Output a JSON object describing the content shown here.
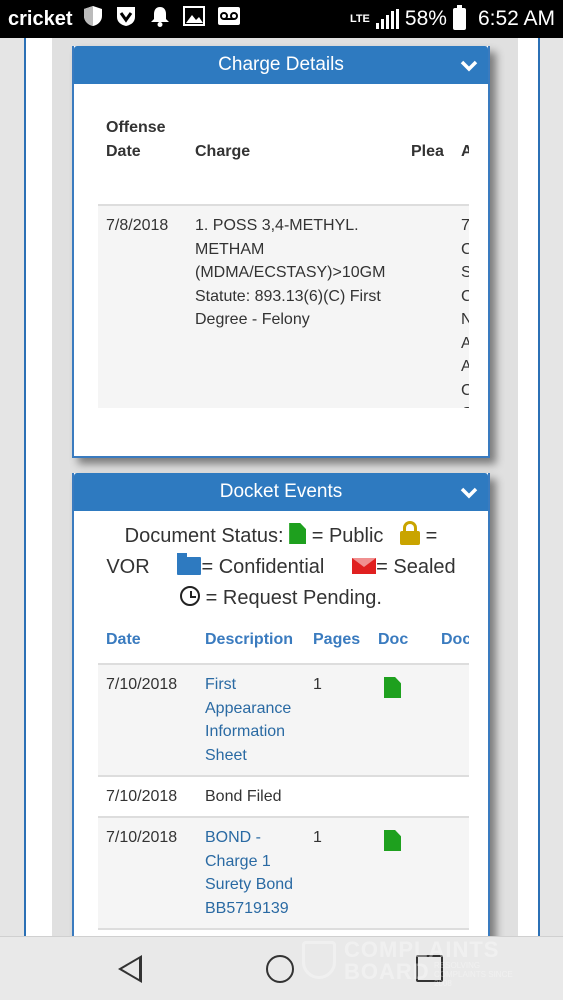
{
  "status_bar": {
    "carrier": "cricket",
    "network": "LTE",
    "battery": "58%",
    "time": "6:52 AM",
    "icons": [
      "shield-icon",
      "vpn-icon",
      "notification-bell-icon",
      "gallery-icon",
      "voicemail-icon"
    ]
  },
  "charge_details": {
    "title": "Charge Details",
    "headers": {
      "offense_date_line1": "Offense",
      "offense_date_line2": "Date",
      "charge": "Charge",
      "plea": "Plea",
      "next": "A"
    },
    "row": {
      "offense_date": "7/8/2018",
      "charge_lines": [
        "1. POSS 3,4-METHYL.",
        "METHAM",
        "(MDMA/ECSTASY)>10GM",
        "Statute: 893.13(6)(C) First",
        "Degree - Felony"
      ],
      "cut_column": [
        "7",
        "C",
        "S",
        "C",
        "N",
        "A",
        "A",
        "C",
        "C"
      ]
    }
  },
  "docket_events": {
    "title": "Docket Events",
    "legend": {
      "prefix": "Document Status:",
      "public": "= Public",
      "vor_eq": "=",
      "vor": "VOR",
      "confidential": "= Confidential",
      "sealed": "= Sealed",
      "pending": "= Request Pending."
    },
    "headers": {
      "date": "Date",
      "description": "Description",
      "pages": "Pages",
      "doc": "Doc",
      "doc2": "Doc"
    },
    "rows": [
      {
        "date": "7/10/2018",
        "description_lines": [
          "First",
          "Appearance",
          "Information",
          "Sheet"
        ],
        "pages": "1",
        "has_doc": true,
        "is_link": true
      },
      {
        "date": "7/10/2018",
        "description_lines": [
          "Bond Filed"
        ],
        "pages": "",
        "has_doc": false,
        "is_link": false
      },
      {
        "date": "7/10/2018",
        "description_lines": [
          "BOND -",
          "Charge 1",
          "Surety Bond",
          "BB5719139"
        ],
        "pages": "1",
        "has_doc": true,
        "is_link": true
      }
    ]
  },
  "watermark": {
    "line1": "COMPLAINTS",
    "line2": "BOARD",
    "tagline": "RESOLVING COMPLAINTS SINCE 2008"
  },
  "colors": {
    "header_blue": "#2e7ac0",
    "link_blue": "#2a6aa3",
    "public_green": "#1ea01e",
    "vor_gold": "#c9a400",
    "sealed_red": "#e02020"
  }
}
